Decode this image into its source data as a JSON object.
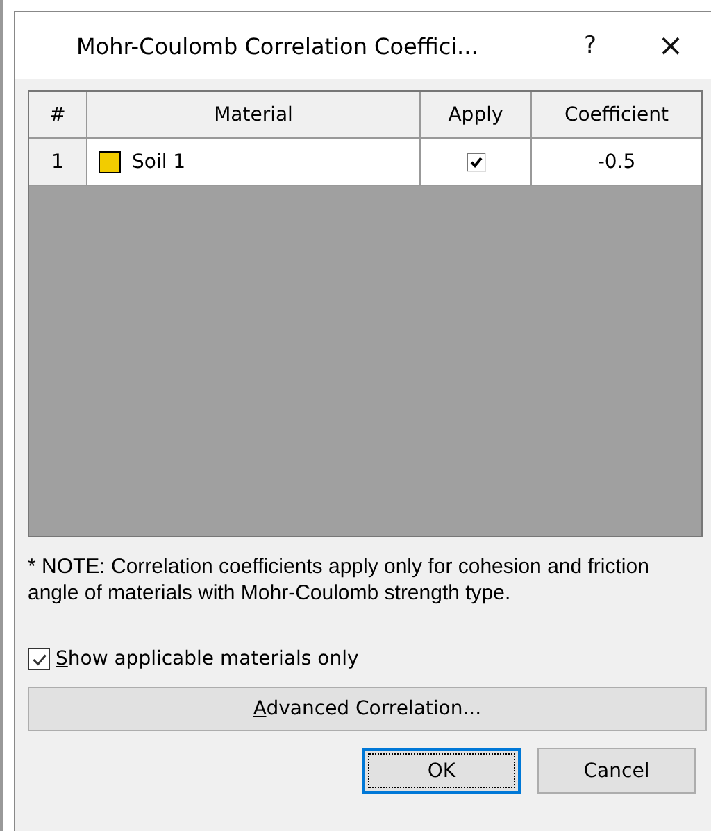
{
  "window": {
    "title": "Mohr-Coulomb Correlation Coeffici...",
    "help": "?",
    "close": "×"
  },
  "table": {
    "columns": [
      "#",
      "Material",
      "Apply",
      "Coefficient"
    ],
    "rows": [
      {
        "index": "1",
        "material": "Soil 1",
        "color": "#f2cc00",
        "apply": true,
        "coefficient": "-0.5"
      }
    ]
  },
  "note": "* NOTE: Correlation coefficients apply only for cohesion and friction angle of materials with Mohr-Coulomb strength type.",
  "show_applicable": {
    "mnemonic": "S",
    "label_rest": "how applicable materials only",
    "checked": true
  },
  "advanced_button": {
    "mnemonic": "A",
    "label_rest": "dvanced Correlation..."
  },
  "buttons": [
    {
      "label": "OK",
      "kind": "default"
    },
    {
      "label": "Cancel",
      "kind": "normal"
    }
  ]
}
